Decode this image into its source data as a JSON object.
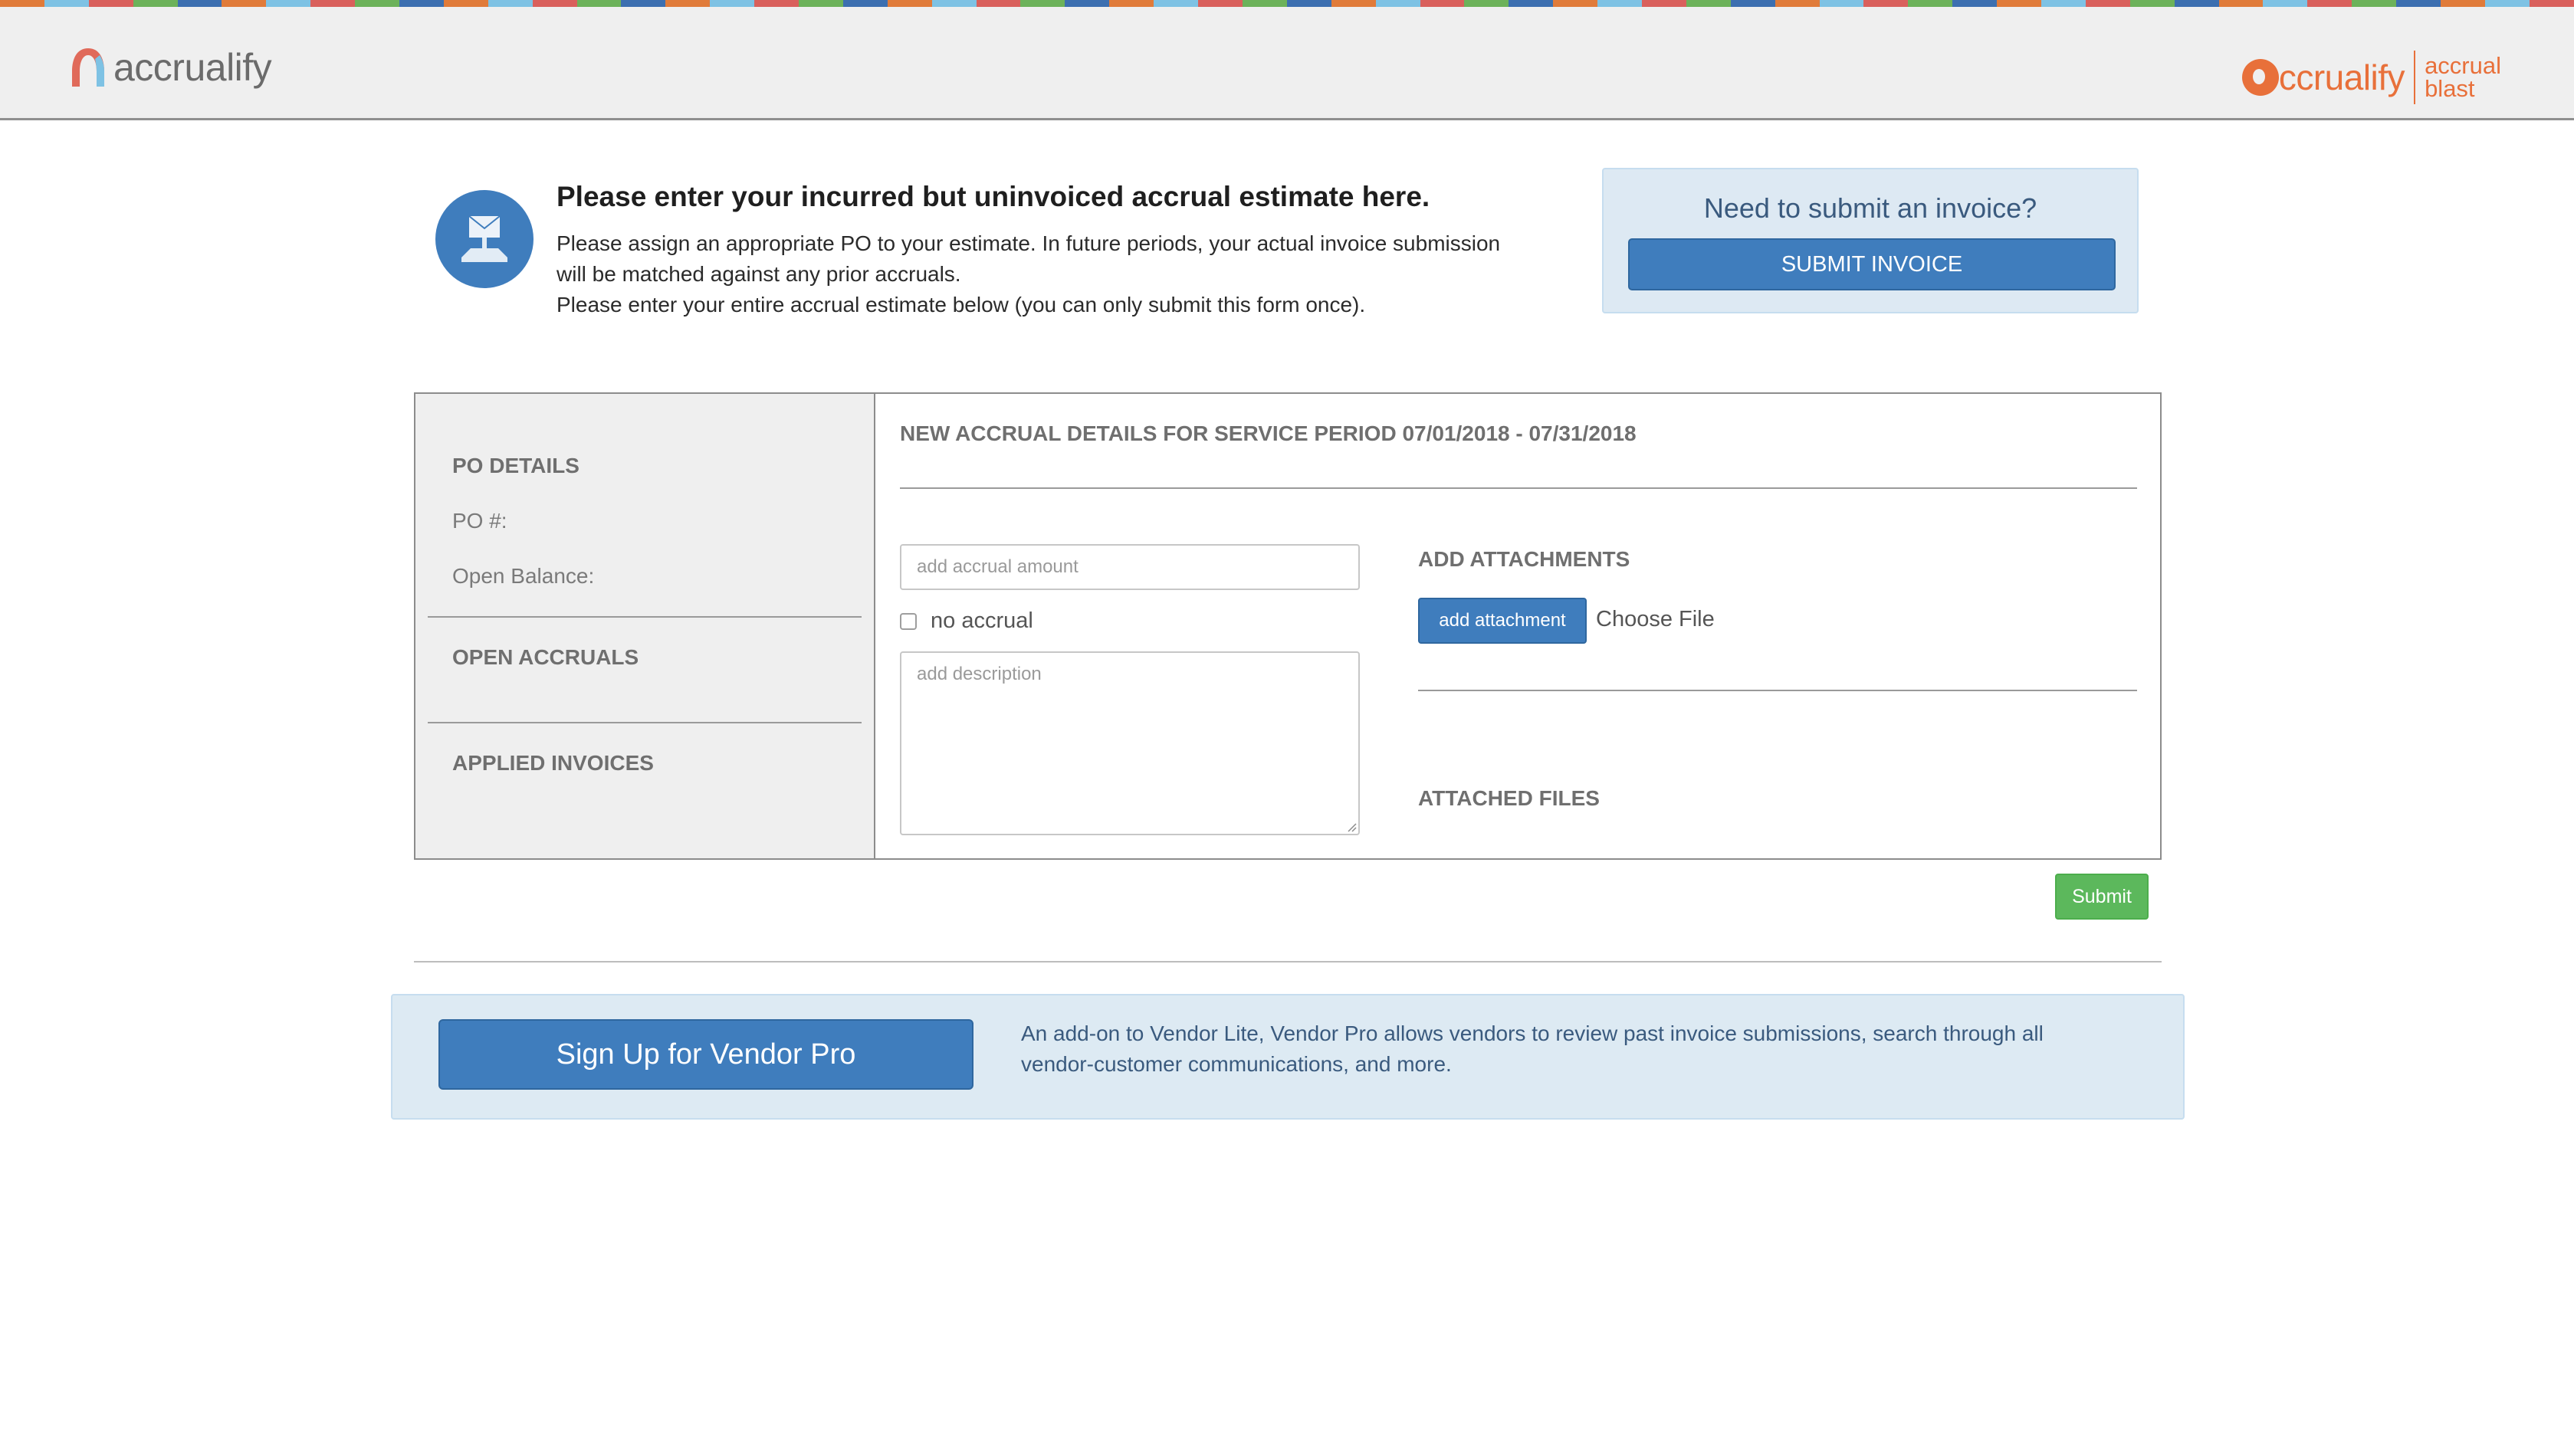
{
  "top_stripe": {
    "colors": [
      "#e07b3a",
      "#7ec2e4",
      "#d9605c",
      "#6cb25a",
      "#3c6fb0"
    ]
  },
  "header": {
    "brand_left": "accrualify",
    "brand_right": {
      "word": "ccrualify",
      "product_line_1": "accrual",
      "product_line_2": "blast"
    }
  },
  "intro": {
    "icon": "envelope-upload-icon",
    "title": "Please enter your incurred but uninvoiced accrual estimate here.",
    "line_1": "Please assign an appropriate PO to your estimate. In future periods, your actual invoice submission",
    "line_2": "will be matched against any prior accruals.",
    "line_3": "Please enter your entire accrual estimate below (you can only submit this form once)."
  },
  "invoice_box": {
    "question": "Need to submit an invoice?",
    "button_label": "SUBMIT INVOICE"
  },
  "left_panel": {
    "po_details_heading": "PO DETAILS",
    "po_number_label": "PO #:",
    "open_balance_label": "Open Balance:",
    "open_accruals_heading": "OPEN ACCRUALS",
    "applied_invoices_heading": "APPLIED INVOICES"
  },
  "form": {
    "period_heading": "NEW ACCRUAL DETAILS FOR SERVICE PERIOD 07/01/2018 - 07/31/2018",
    "accrual_amount_placeholder": "add accrual amount",
    "accrual_amount_value": "",
    "no_accrual_label": "no accrual",
    "no_accrual_checked": false,
    "description_placeholder": "add description",
    "description_value": "",
    "attachments_heading": "ADD ATTACHMENTS",
    "add_attachment_label": "add attachment",
    "choose_file_label": "Choose File",
    "attached_files_heading": "ATTACHED FILES",
    "submit_label": "Submit"
  },
  "promo": {
    "button_label": "Sign Up for Vendor Pro",
    "line_1": "An add-on to Vendor Lite, Vendor Pro allows vendors to review past invoice submissions, search through all",
    "line_2": "vendor-customer communications, and more."
  },
  "colors": {
    "primary_blue": "#3f7dbd",
    "submit_green": "#5cb85c",
    "brand_orange": "#e8703a",
    "panel_gray": "#efefef",
    "info_blue_bg": "#ddeaf3"
  }
}
